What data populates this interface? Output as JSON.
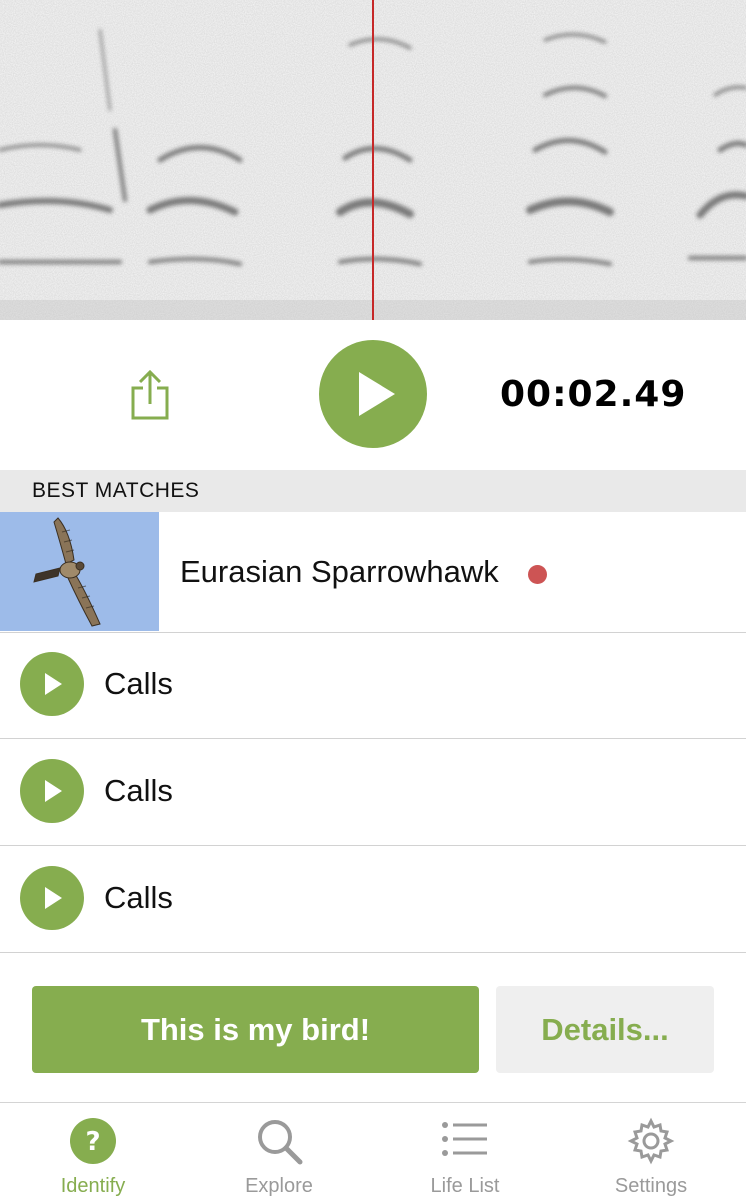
{
  "player": {
    "time": "00:02.49"
  },
  "section": {
    "title": "BEST MATCHES"
  },
  "match": {
    "species": "Eurasian Sparrowhawk",
    "range_dot_color": "#cd5454"
  },
  "sounds": [
    {
      "label": "Calls"
    },
    {
      "label": "Calls"
    },
    {
      "label": "Calls"
    }
  ],
  "actions": {
    "confirm_label": "This is my bird!",
    "details_label": "Details..."
  },
  "tabs": [
    {
      "label": "Identify",
      "icon": "question-circle-icon",
      "active": true
    },
    {
      "label": "Explore",
      "icon": "search-icon",
      "active": false
    },
    {
      "label": "Life List",
      "icon": "list-icon",
      "active": false
    },
    {
      "label": "Settings",
      "icon": "gear-icon",
      "active": false
    }
  ],
  "colors": {
    "accent": "#86ad4f",
    "playhead": "#c62828",
    "inactive_tab": "#9a9a9a"
  }
}
